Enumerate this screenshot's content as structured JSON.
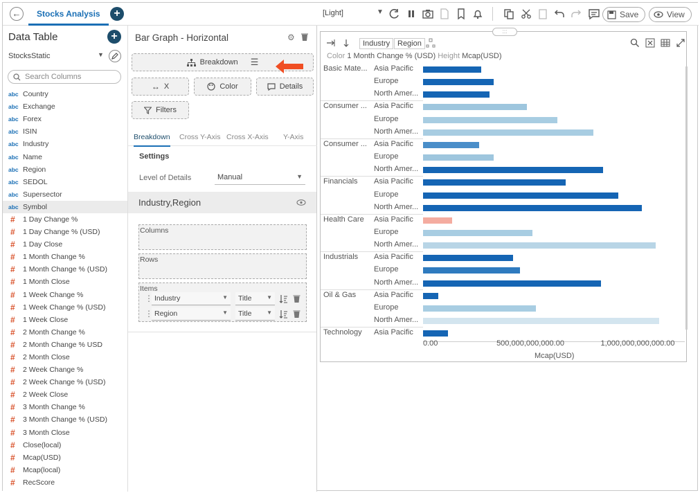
{
  "topbar": {
    "tab_label": "Stocks Analysis",
    "theme": "[Light]",
    "save_label": "Save",
    "view_label": "View"
  },
  "data_table": {
    "title": "Data Table",
    "datasource": "StocksStatic",
    "search_placeholder": "Search Columns",
    "columns": [
      {
        "type": "abc",
        "name": "Country"
      },
      {
        "type": "abc",
        "name": "Exchange"
      },
      {
        "type": "abc",
        "name": "Forex"
      },
      {
        "type": "abc",
        "name": "ISIN"
      },
      {
        "type": "abc",
        "name": "Industry"
      },
      {
        "type": "abc",
        "name": "Name"
      },
      {
        "type": "abc",
        "name": "Region"
      },
      {
        "type": "abc",
        "name": "SEDOL"
      },
      {
        "type": "abc",
        "name": "Supersector"
      },
      {
        "type": "abc",
        "name": "Symbol"
      },
      {
        "type": "#",
        "name": "1 Day Change %"
      },
      {
        "type": "#",
        "name": "1 Day Change % (USD)"
      },
      {
        "type": "#",
        "name": "1 Day Close"
      },
      {
        "type": "#",
        "name": "1 Month Change %"
      },
      {
        "type": "#",
        "name": "1 Month Change % (USD)"
      },
      {
        "type": "#",
        "name": "1 Month Close"
      },
      {
        "type": "#",
        "name": "1 Week Change %"
      },
      {
        "type": "#",
        "name": "1 Week Change % (USD)"
      },
      {
        "type": "#",
        "name": "1 Week Close"
      },
      {
        "type": "#",
        "name": "2 Month Change %"
      },
      {
        "type": "#",
        "name": "2 Month Change % USD"
      },
      {
        "type": "#",
        "name": "2 Month Close"
      },
      {
        "type": "#",
        "name": "2 Week Change %"
      },
      {
        "type": "#",
        "name": "2 Week Change % (USD)"
      },
      {
        "type": "#",
        "name": "2 Week Close"
      },
      {
        "type": "#",
        "name": "3 Month Change %"
      },
      {
        "type": "#",
        "name": "3 Month Change % (USD)"
      },
      {
        "type": "#",
        "name": "3 Month Close"
      },
      {
        "type": "#",
        "name": "Close(local)"
      },
      {
        "type": "#",
        "name": "Mcap(USD)"
      },
      {
        "type": "#",
        "name": "Mcap(local)"
      },
      {
        "type": "#",
        "name": "RecScore"
      }
    ],
    "selected_column": "Symbol"
  },
  "editor": {
    "title": "Bar Graph - Horizontal",
    "breakdown_label": "Breakdown",
    "x_label": "X",
    "color_label": "Color",
    "details_label": "Details",
    "filters_label": "Filters",
    "tabs": [
      "Breakdown",
      "Cross Y-Axis",
      "Cross X-Axis",
      "Y-Axis"
    ],
    "settings_label": "Settings",
    "lod_label": "Level of Details",
    "lod_value": "Manual",
    "breakdown_value": "Industry,Region",
    "columns_label": "Columns",
    "rows_label": "Rows",
    "items_label": "Items",
    "items": [
      {
        "field": "Industry",
        "mode": "Title"
      },
      {
        "field": "Region",
        "mode": "Title"
      }
    ]
  },
  "chart_panel": {
    "chips": [
      "Industry",
      "Region"
    ],
    "legend_color_label": "Color",
    "legend_color_value": "1 Month Change % (USD)",
    "legend_height_label": "Height",
    "legend_height_value": "Mcap(USD)"
  },
  "chart_data": {
    "type": "bar",
    "orientation": "horizontal",
    "xlabel": "Mcap(USD)",
    "xlim": [
      0,
      1050000000000
    ],
    "xticks": [
      "0.00",
      "500,000,000,000.00",
      "1,000,000,000,000.00"
    ],
    "groups": [
      {
        "industry": "Basic Mate...",
        "rows": [
          {
            "region": "Asia Pacific",
            "value": 270000000000,
            "color": "#1565b4"
          },
          {
            "region": "Europe",
            "value": 330000000000,
            "color": "#1565b4"
          },
          {
            "region": "North Amer...",
            "value": 310000000000,
            "color": "#1565b4"
          }
        ]
      },
      {
        "industry": "Consumer ...",
        "rows": [
          {
            "region": "Asia Pacific",
            "value": 485000000000,
            "color": "#9ec6de"
          },
          {
            "region": "Europe",
            "value": 625000000000,
            "color": "#a8cde2"
          },
          {
            "region": "North Amer...",
            "value": 795000000000,
            "color": "#a8cde2"
          }
        ]
      },
      {
        "industry": "Consumer ...",
        "rows": [
          {
            "region": "Asia Pacific",
            "value": 260000000000,
            "color": "#4a8ec9"
          },
          {
            "region": "Europe",
            "value": 330000000000,
            "color": "#9ec6de"
          },
          {
            "region": "North Amer...",
            "value": 840000000000,
            "color": "#1565b4"
          }
        ]
      },
      {
        "industry": "Financials",
        "rows": [
          {
            "region": "Asia Pacific",
            "value": 665000000000,
            "color": "#1565b4"
          },
          {
            "region": "Europe",
            "value": 910000000000,
            "color": "#1565b4"
          },
          {
            "region": "North Amer...",
            "value": 1020000000000,
            "color": "#1565b4"
          }
        ]
      },
      {
        "industry": "Health Care",
        "rows": [
          {
            "region": "Asia Pacific",
            "value": 135000000000,
            "color": "#f4aca0"
          },
          {
            "region": "Europe",
            "value": 510000000000,
            "color": "#a8cde2"
          },
          {
            "region": "North Amer...",
            "value": 1085000000000,
            "color": "#b8d5e6"
          }
        ]
      },
      {
        "industry": "Industrials",
        "rows": [
          {
            "region": "Asia Pacific",
            "value": 420000000000,
            "color": "#1565b4"
          },
          {
            "region": "Europe",
            "value": 450000000000,
            "color": "#2f7bbf"
          },
          {
            "region": "North Amer...",
            "value": 830000000000,
            "color": "#1565b4"
          }
        ]
      },
      {
        "industry": "Oil & Gas",
        "rows": [
          {
            "region": "Asia Pacific",
            "value": 72000000000,
            "color": "#1565b4"
          },
          {
            "region": "Europe",
            "value": 525000000000,
            "color": "#a8cde2"
          },
          {
            "region": "North Amer...",
            "value": 1100000000000,
            "color": "#d3e5ef"
          }
        ]
      },
      {
        "industry": "Technology",
        "rows": [
          {
            "region": "Asia Pacific",
            "value": 115000000000,
            "color": "#1565b4"
          }
        ]
      }
    ]
  }
}
